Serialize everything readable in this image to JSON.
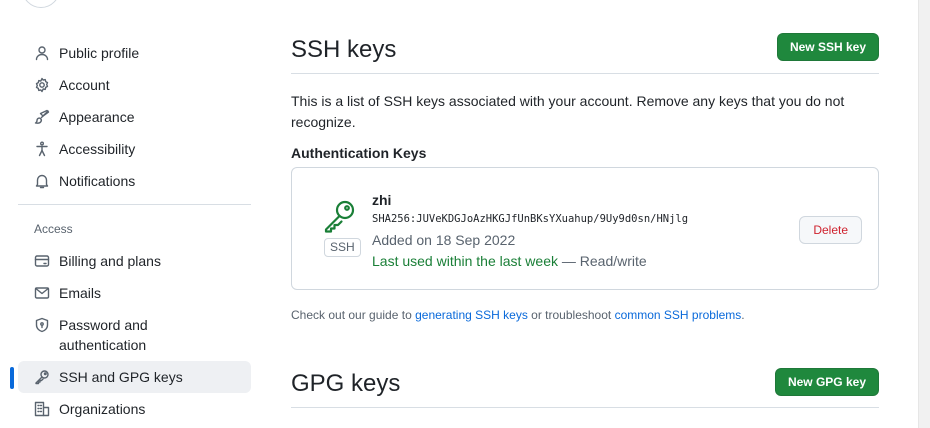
{
  "sidebar": {
    "items_top": [
      {
        "label": "Public profile",
        "icon": "person-icon"
      },
      {
        "label": "Account",
        "icon": "gear-icon"
      },
      {
        "label": "Appearance",
        "icon": "paintbrush-icon"
      },
      {
        "label": "Accessibility",
        "icon": "accessibility-icon"
      },
      {
        "label": "Notifications",
        "icon": "bell-icon"
      }
    ],
    "group_label": "Access",
    "items_access": [
      {
        "label": "Billing and plans",
        "icon": "credit-card-icon"
      },
      {
        "label": "Emails",
        "icon": "mail-icon"
      },
      {
        "label": "Password and authentication",
        "icon": "shield-lock-icon"
      },
      {
        "label": "SSH and GPG keys",
        "icon": "key-icon",
        "selected": true
      },
      {
        "label": "Organizations",
        "icon": "organization-icon"
      }
    ]
  },
  "ssh": {
    "title": "SSH keys",
    "new_button": "New SSH key",
    "description": "This is a list of SSH keys associated with your account. Remove any keys that you do not recognize.",
    "auth_heading": "Authentication Keys",
    "keys": [
      {
        "name": "zhi",
        "fingerprint": "SHA256:JUVeKDGJoAzHKGJfUnBKsYXuahup/9Uy9d0sn/HNjlg",
        "added": "Added on 18 Sep 2022",
        "last_used": "Last used within the last week",
        "access": "— Read/write",
        "type_label": "SSH",
        "delete_label": "Delete"
      }
    ],
    "guide": {
      "prefix": "Check out our guide to",
      "link1": "generating SSH keys",
      "middle": "or troubleshoot",
      "link2": "common SSH problems",
      "suffix": "."
    }
  },
  "gpg": {
    "title": "GPG keys",
    "new_button": "New GPG key"
  },
  "colors": {
    "accent": "#0969da",
    "primary_button": "#1f883d",
    "success_text": "#1a7f37",
    "danger_text": "#cf222e"
  }
}
